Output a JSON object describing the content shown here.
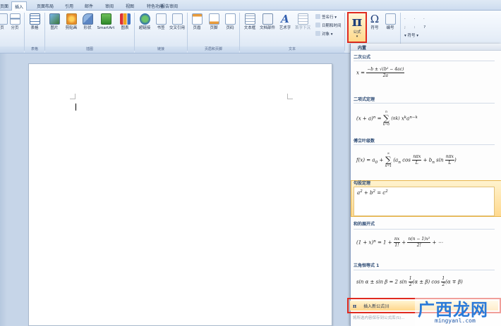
{
  "tabs": [
    "页面",
    "插入",
    "页面布局",
    "引用",
    "邮件",
    "审阅",
    "视图",
    "特色功能",
    "报告审阅"
  ],
  "ribbon": {
    "buttons": {
      "page": "页",
      "page_break": "分页",
      "table": "表格",
      "picture": "图片",
      "clipart": "剪贴画",
      "shapes": "形状",
      "smartart": "SmartArt",
      "chart": "图表",
      "hyperlink": "超链接",
      "bookmark": "书签",
      "crossref": "交叉引用",
      "header": "页眉",
      "footer": "页脚",
      "page_number": "页码",
      "textbox": "文本框",
      "quickparts": "文档部件",
      "wordart": "艺术字",
      "dropcap": "首字下沉",
      "signature": "签名行",
      "datetime": "日期和时间",
      "object": "对象",
      "equation": "公式",
      "symbol": "符号",
      "number": "编号",
      "special_symbol": "符号"
    },
    "groups": {
      "tables": "表格",
      "illustrations": "插图",
      "links": "链接",
      "header_footer": "页眉和页脚",
      "text": "文本"
    },
    "equation_glyph": "π",
    "symbol_glyph": "Ω"
  },
  "gallery": {
    "header": "内置",
    "equations": [
      {
        "title": "二次公式"
      },
      {
        "title": "二项式定理"
      },
      {
        "title": "傅立叶级数"
      },
      {
        "title": "勾股定理"
      },
      {
        "title": "和的展开式"
      },
      {
        "title": "三角恒等式 1"
      }
    ],
    "insert_new": "插入新公式(I)",
    "insert_new_glyph": "π",
    "save_selection": "将所选内容保存到公式库(S)..."
  },
  "watermark": {
    "text": "广西龙网",
    "url": "mingyanl.com"
  }
}
